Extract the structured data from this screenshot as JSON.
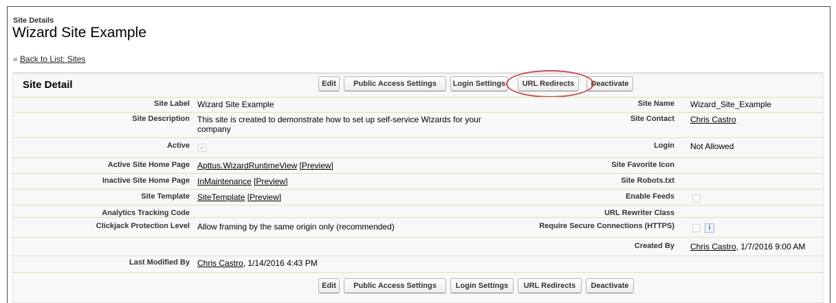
{
  "header": {
    "subtitle": "Site Details",
    "title": "Wizard Site Example",
    "back_prefix": "«",
    "back_link": "Back to List: Sites"
  },
  "section": {
    "title": "Site Detail"
  },
  "buttons": {
    "edit": "Edit",
    "public_access": "Public Access Settings",
    "login_settings_top": "Login Settings",
    "login_settings": "Login Settings",
    "url_redirects": "URL Redirects",
    "deactivate": "Deactivate"
  },
  "fields": {
    "site_label": {
      "label": "Site Label",
      "value": "Wizard Site Example"
    },
    "site_name": {
      "label": "Site Name",
      "value": "Wizard_Site_Example"
    },
    "site_description": {
      "label": "Site Description",
      "value": "This site is created to demonstrate how to set up self-service Wizards for your company"
    },
    "site_contact": {
      "label": "Site Contact",
      "value": "Chris Castro"
    },
    "active": {
      "label": "Active",
      "checked": true
    },
    "login": {
      "label": "Login",
      "value": "Not Allowed"
    },
    "active_home": {
      "label": "Active Site Home Page",
      "value": "Apttus.WizardRuntimeView",
      "preview": "[Preview]"
    },
    "favicon": {
      "label": "Site Favorite Icon",
      "value": ""
    },
    "inactive_home": {
      "label": "Inactive Site Home Page",
      "value": "InMaintenance",
      "preview": "[Preview]"
    },
    "robots": {
      "label": "Site Robots.txt",
      "value": ""
    },
    "template": {
      "label": "Site Template",
      "value": "SiteTemplate",
      "preview": "[Preview]"
    },
    "enable_feeds": {
      "label": "Enable Feeds",
      "checked": false
    },
    "analytics": {
      "label": "Analytics Tracking Code",
      "value": ""
    },
    "url_rewriter": {
      "label": "URL Rewriter Class",
      "value": ""
    },
    "clickjack": {
      "label": "Clickjack Protection Level",
      "value": "Allow framing by the same origin only (recommended)"
    },
    "https": {
      "label": "Require Secure Connections (HTTPS)",
      "checked": false,
      "info_icon": "i"
    },
    "created_by": {
      "label": "Created By",
      "user": "Chris Castro",
      "date": ", 1/7/2016 9:00 AM"
    },
    "last_modified": {
      "label": "Last Modified By",
      "user": "Chris Castro",
      "date": ", 1/14/2016 4:43 PM"
    }
  },
  "icons": {
    "checkmark": "checkmark-icon",
    "info": "info-icon"
  },
  "colors": {
    "highlight": "#c0504d",
    "row_separator": "#e3deb8"
  }
}
